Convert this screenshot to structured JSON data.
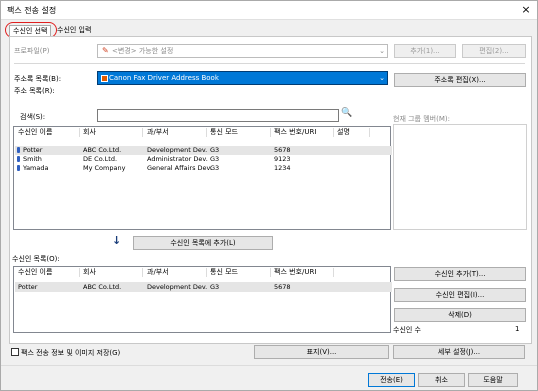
{
  "window": {
    "title": "팩스 전송 설정",
    "close": "×"
  },
  "tabs": [
    {
      "label": "수신인 선택"
    },
    {
      "label": "수신인 입력"
    }
  ],
  "profile": {
    "label": "프로파일(P)",
    "value": "<변경> 가능한 설정",
    "add": "추가(1)...",
    "edit": "편집(2)..."
  },
  "addressbook": {
    "label": "주소록 목록(B):",
    "selected": "Canon Fax Driver Address Book",
    "edit_button": "주소록 편집(X)...",
    "list_label": "주소 목록(R):",
    "search_label": "검색(S):",
    "search_value": "",
    "columns": [
      "수신인 이름",
      "회사",
      "과/부서",
      "통신 모드",
      "팩스 번호/URI",
      "설명"
    ],
    "rows": [
      {
        "name": "Potter",
        "company": "ABC Co.Ltd.",
        "dept": "Development Dev.",
        "mode": "G3",
        "fax": "5678",
        "desc": ""
      },
      {
        "name": "Smith",
        "company": "DE Co.Ltd.",
        "dept": "Administrator Dev.",
        "mode": "G3",
        "fax": "9123",
        "desc": ""
      },
      {
        "name": "Yamada",
        "company": "My Company",
        "dept": "General Affairs Dev.",
        "mode": "G3",
        "fax": "1234",
        "desc": ""
      }
    ],
    "group_members_label": "현재 그룹 멤버(M):"
  },
  "add_to_list": {
    "arrow": "↓",
    "button": "수신인 목록에 추가(L)"
  },
  "recipients": {
    "label": "수신인 목록(O):",
    "columns": [
      "수신인 이름",
      "회사",
      "과/부서",
      "통신 모드",
      "팩스 번호/URI"
    ],
    "rows": [
      {
        "name": "Potter",
        "company": "ABC Co.Ltd.",
        "dept": "Development Dev.",
        "mode": "G3",
        "fax": "5678"
      }
    ],
    "add_button": "수신인 추가(T)...",
    "edit_button": "수신인 편집(I)...",
    "delete_button": "삭제(D)",
    "count_label": "수신인 수",
    "count_value": "1"
  },
  "options": {
    "save_checkbox": "팩스 전송 정보 및 이미지 저장(G)",
    "cover_button": "표지(V)...",
    "detail_button": "세부 설정(J)..."
  },
  "footer": {
    "send": "전송(E)",
    "cancel": "취소",
    "help": "도움말"
  },
  "colors": {
    "accent": "#0078d7",
    "highlight_oval": "#e02020"
  }
}
